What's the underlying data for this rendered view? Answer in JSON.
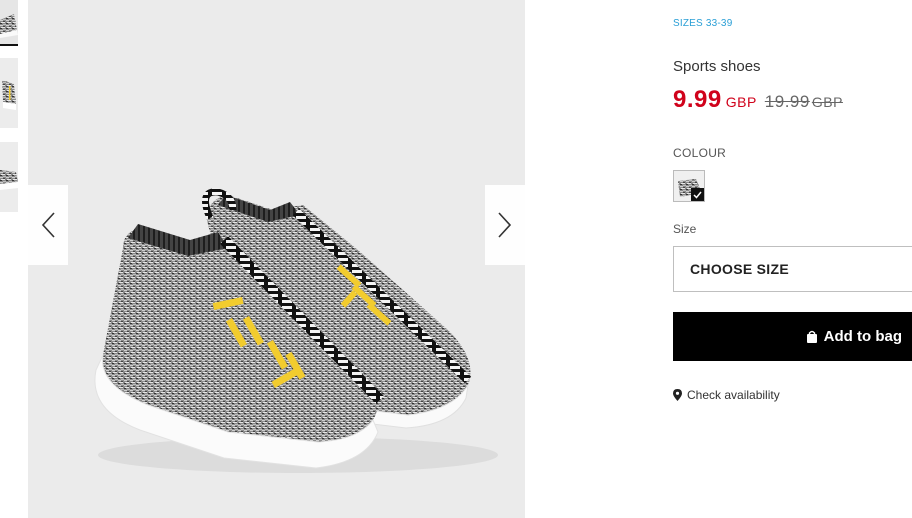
{
  "product": {
    "sizes_range": "SIZES 33-39",
    "name": "Sports shoes",
    "price_current": "9.99",
    "currency_current": "GBP",
    "price_original": "19.99",
    "currency_original": "GBP"
  },
  "colour": {
    "label": "COLOUR",
    "selected_swatch": "grey-melange"
  },
  "size": {
    "label": "Size",
    "select_value": "CHOOSE SIZE"
  },
  "actions": {
    "add_to_bag": "Add to bag",
    "check_availability": "Check availability"
  },
  "icons": {
    "prev": "chevron-left-icon",
    "next": "chevron-right-icon",
    "bag": "shopping-bag-icon",
    "pin": "map-pin-icon",
    "check": "checkmark-icon"
  },
  "colors": {
    "accent_red": "#d0021b",
    "sizes_blue": "#2a9fd6",
    "button_black": "#000000",
    "shoe_lettering": "#f2cc2e"
  }
}
